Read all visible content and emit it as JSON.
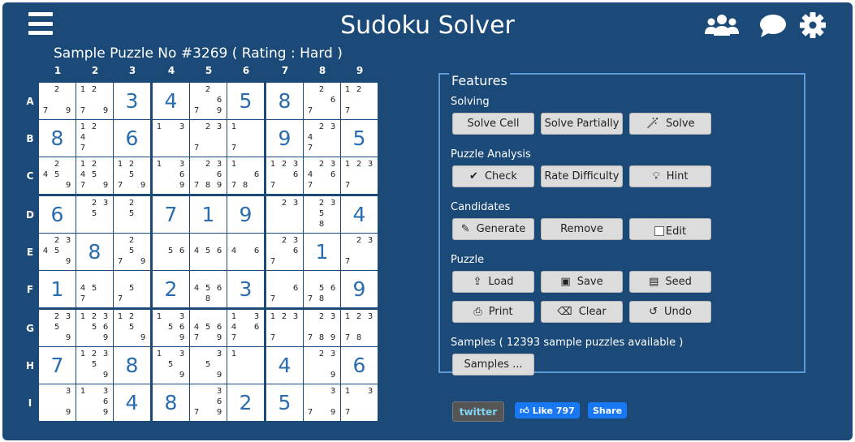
{
  "header": {
    "title": "Sudoku Solver",
    "menu_icon": "hamburger-menu-icon",
    "community_icon": "users-icon",
    "chat_icon": "chat-bubble-icon",
    "settings_icon": "gear-icon"
  },
  "puzzle": {
    "title": "Sample Puzzle No #3269 ( Rating : Hard )",
    "col_labels": [
      "1",
      "2",
      "3",
      "4",
      "5",
      "6",
      "7",
      "8",
      "9"
    ],
    "row_labels": [
      "A",
      "B",
      "C",
      "D",
      "E",
      "F",
      "G",
      "H",
      "I"
    ],
    "cells": [
      [
        {
          "c": [
            2,
            7,
            9
          ]
        },
        {
          "c": [
            1,
            2,
            7,
            9
          ]
        },
        {
          "v": "3"
        },
        {
          "v": "4"
        },
        {
          "c": [
            2,
            6,
            7,
            9
          ]
        },
        {
          "v": "5"
        },
        {
          "v": "8"
        },
        {
          "c": [
            2,
            6,
            7
          ]
        },
        {
          "c": [
            1,
            2,
            7
          ]
        }
      ],
      [
        {
          "v": "8"
        },
        {
          "c": [
            1,
            2,
            4,
            7
          ]
        },
        {
          "v": "6"
        },
        {
          "c": [
            1,
            3
          ]
        },
        {
          "c": [
            2,
            3,
            7
          ]
        },
        {
          "c": [
            1,
            7
          ]
        },
        {
          "v": "9"
        },
        {
          "c": [
            2,
            3,
            4,
            7
          ]
        },
        {
          "v": "5"
        }
      ],
      [
        {
          "c": [
            2,
            4,
            5,
            9
          ]
        },
        {
          "c": [
            1,
            2,
            4,
            5,
            7,
            9
          ]
        },
        {
          "c": [
            1,
            2,
            5,
            7,
            9
          ]
        },
        {
          "c": [
            1,
            3,
            6,
            9
          ]
        },
        {
          "c": [
            2,
            3,
            6,
            7,
            8,
            9
          ]
        },
        {
          "c": [
            1,
            6,
            7,
            8
          ]
        },
        {
          "c": [
            1,
            2,
            3,
            6,
            7
          ]
        },
        {
          "c": [
            2,
            3,
            4,
            6,
            7
          ]
        },
        {
          "c": [
            1,
            2,
            3,
            7
          ]
        }
      ],
      [
        {
          "v": "6"
        },
        {
          "c": [
            2,
            3,
            5
          ]
        },
        {
          "c": [
            2,
            5
          ]
        },
        {
          "v": "7"
        },
        {
          "v": "1"
        },
        {
          "v": "9"
        },
        {
          "c": [
            2,
            3
          ]
        },
        {
          "c": [
            2,
            3,
            5,
            8
          ]
        },
        {
          "v": "4"
        }
      ],
      [
        {
          "c": [
            2,
            3,
            4,
            5,
            9
          ]
        },
        {
          "v": "8"
        },
        {
          "c": [
            2,
            5,
            7,
            9
          ]
        },
        {
          "c": [
            5,
            6
          ]
        },
        {
          "c": [
            4,
            5,
            6
          ]
        },
        {
          "c": [
            4,
            6
          ]
        },
        {
          "c": [
            2,
            3,
            6,
            7
          ]
        },
        {
          "v": "1"
        },
        {
          "c": [
            2,
            3,
            7
          ]
        }
      ],
      [
        {
          "v": "1"
        },
        {
          "c": [
            4,
            5,
            7
          ]
        },
        {
          "c": [
            5,
            7
          ]
        },
        {
          "v": "2"
        },
        {
          "c": [
            4,
            5,
            6,
            8
          ]
        },
        {
          "v": "3"
        },
        {
          "c": [
            6,
            7
          ]
        },
        {
          "c": [
            5,
            6,
            7,
            8
          ]
        },
        {
          "v": "9"
        }
      ],
      [
        {
          "c": [
            2,
            3,
            5,
            9
          ]
        },
        {
          "c": [
            1,
            2,
            3,
            5,
            6,
            9
          ]
        },
        {
          "c": [
            1,
            2,
            5,
            9
          ]
        },
        {
          "c": [
            1,
            3,
            5,
            6,
            9
          ]
        },
        {
          "c": [
            4,
            5,
            6,
            7,
            9
          ]
        },
        {
          "c": [
            1,
            3,
            4,
            6,
            7
          ]
        },
        {
          "c": [
            1,
            2,
            3,
            7
          ]
        },
        {
          "c": [
            2,
            3,
            7,
            8,
            9
          ]
        },
        {
          "c": [
            1,
            2,
            3,
            7,
            8
          ]
        }
      ],
      [
        {
          "v": "7"
        },
        {
          "c": [
            1,
            2,
            3,
            5,
            9
          ]
        },
        {
          "v": "8"
        },
        {
          "c": [
            1,
            3,
            5,
            9
          ]
        },
        {
          "c": [
            3,
            5,
            9
          ]
        },
        {
          "c": [
            1
          ]
        },
        {
          "v": "4"
        },
        {
          "c": [
            2,
            3,
            9
          ]
        },
        {
          "v": "6"
        }
      ],
      [
        {
          "c": [
            3,
            9
          ]
        },
        {
          "c": [
            1,
            3,
            6,
            9
          ]
        },
        {
          "v": "4"
        },
        {
          "v": "8"
        },
        {
          "c": [
            3,
            6,
            7,
            9
          ]
        },
        {
          "v": "2"
        },
        {
          "v": "5"
        },
        {
          "c": [
            3,
            7,
            9
          ]
        },
        {
          "c": [
            1,
            3,
            7
          ]
        }
      ]
    ]
  },
  "features": {
    "legend": "Features",
    "solving": {
      "label": "Solving",
      "solve_cell": "Solve Cell",
      "solve_partially": "Solve Partially",
      "solve": "Solve"
    },
    "analysis": {
      "label": "Puzzle Analysis",
      "check": "Check",
      "rate": "Rate Difficulty",
      "hint": "Hint"
    },
    "candidates": {
      "label": "Candidates",
      "generate": "Generate",
      "remove": "Remove",
      "edit": "Edit",
      "edit_checked": false
    },
    "puzzle": {
      "label": "Puzzle",
      "load": "Load",
      "save": "Save",
      "seed": "Seed",
      "print": "Print",
      "clear": "Clear",
      "undo": "Undo"
    },
    "samples": {
      "label": "Samples ( 12393 sample puzzles available )",
      "button": "Samples ..."
    }
  },
  "social": {
    "twitter": "twitter",
    "like": "Like 797",
    "share": "Share"
  },
  "colors": {
    "background": "#1b4a78",
    "given_digit": "#2a6cb0",
    "fieldset_border": "#5e9bd6",
    "button": "#dcdcdc"
  }
}
